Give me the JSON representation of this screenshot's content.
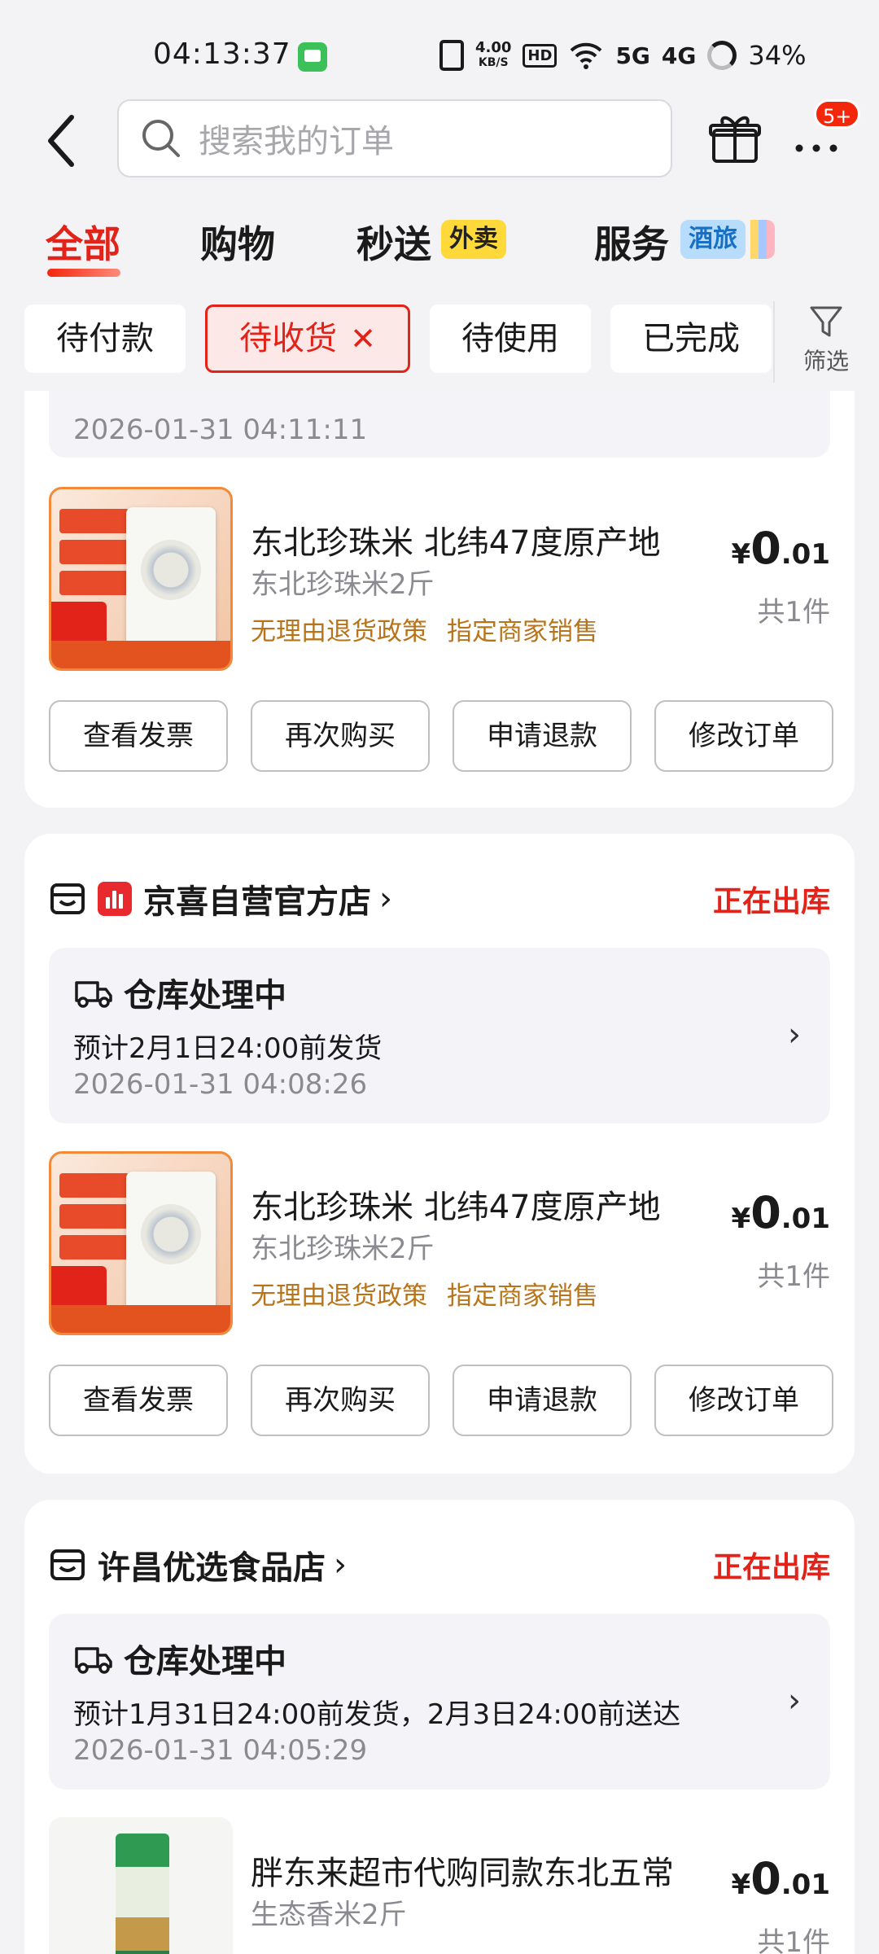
{
  "status_bar": {
    "time": "04:13:37",
    "net_speed_value": "4.00",
    "net_speed_unit": "KB/S",
    "hd_label": "HD",
    "sig1": "5G",
    "sig2": "4G",
    "battery": "34%"
  },
  "header": {
    "search_placeholder": "搜索我的订单",
    "badge": "5+"
  },
  "tabs": {
    "all": "全部",
    "shopping": "购物",
    "instant": "秒送",
    "instant_tag": "外卖",
    "service": "服务",
    "service_tag": "酒旅"
  },
  "filters": {
    "pending_payment": "待付款",
    "pending_receipt": "待收货",
    "pending_use": "待使用",
    "completed": "已完成",
    "filter_label": "筛选"
  },
  "orders": [
    {
      "time": "2026-01-31 04:11:11",
      "product": {
        "name": "东北珍珠米 北纬47度原产地",
        "spec": "东北珍珠米2斤",
        "policy1": "无理由退货政策",
        "policy2": "指定商家销售",
        "price_currency": "¥",
        "price_int": "0",
        "price_dec": ".01",
        "qty": "共1件"
      },
      "actions": [
        "查看发票",
        "再次购买",
        "申请退款",
        "修改订单"
      ]
    },
    {
      "shop_name": "京喜自营官方店",
      "status": "正在出库",
      "shipping_title": "仓库处理中",
      "shipping_desc": "预计2月1日24:00前发货",
      "time": "2026-01-31 04:08:26",
      "product": {
        "name": "东北珍珠米 北纬47度原产地",
        "spec": "东北珍珠米2斤",
        "policy1": "无理由退货政策",
        "policy2": "指定商家销售",
        "price_currency": "¥",
        "price_int": "0",
        "price_dec": ".01",
        "qty": "共1件"
      },
      "actions": [
        "查看发票",
        "再次购买",
        "申请退款",
        "修改订单"
      ]
    },
    {
      "shop_name": "许昌优选食品店",
      "status": "正在出库",
      "shipping_title": "仓库处理中",
      "shipping_desc": "预计1月31日24:00前发货，2月3日24:00前送达",
      "time": "2026-01-31 04:05:29",
      "product": {
        "name": "胖东来超市代购同款东北五常",
        "spec": "生态香米2斤",
        "price_currency": "¥",
        "price_int": "0",
        "price_dec": ".01",
        "qty": "共1件"
      }
    }
  ],
  "colors": {
    "accent_red": "#e2231a",
    "policy_brown": "#b8741a",
    "page_bg": "#f3f3f6"
  }
}
